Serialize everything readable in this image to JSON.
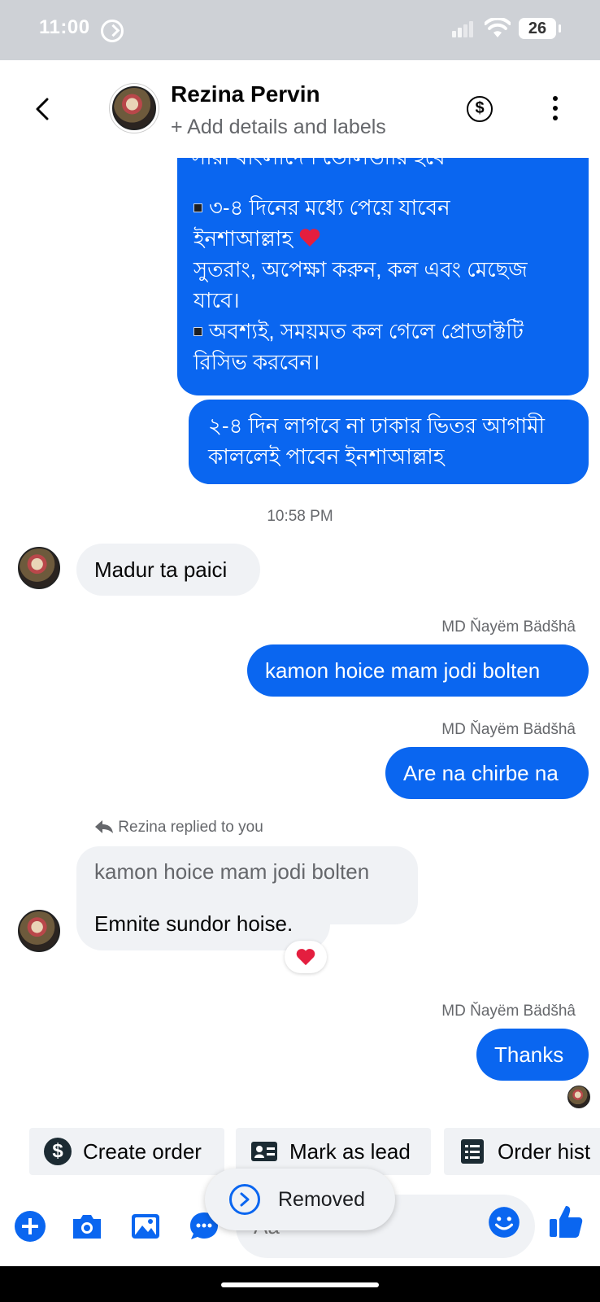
{
  "status_bar": {
    "time": "11:00",
    "battery": "26"
  },
  "header": {
    "contact_name": "Rezina Pervin",
    "subtitle": "+ Add details and labels",
    "dollar_icon": "$"
  },
  "messages": {
    "msg1_partial_top": "সারা বাংলাদেশ ডেলিভারি হবে",
    "msg1_line1": "৩-৪ দিনের মধ্যে পেয়ে যাবেন",
    "msg1_line2": "ইনশাআল্লাহ",
    "msg1_line3": "সুতরাং, অপেক্ষা করুন, কল এবং মেছেজ",
    "msg1_line4": "যাবে।",
    "msg1_line5": "অবশ্যই, সময়মত কল গেলে প্রোডাক্টটি",
    "msg1_line6": "রিসিভ করবেন।",
    "msg2_line1": "২-৪ দিন লাগবে না ঢাকার ভিতর আগামী",
    "msg2_line2": "কাললেই পাবেন ইনশাআল্লাহ",
    "timestamp": "10:58 PM",
    "msg3": "Madur ta paici",
    "sender1": "MD Ňayëm Bädšhâ",
    "msg4": "kamon hoice mam jodi bolten",
    "sender2": "MD Ňayëm Bädšhâ",
    "msg5": "Are na chirbe na",
    "reply_label": "Rezina replied to you",
    "quoted_text": "kamon hoice mam jodi bolten",
    "msg6": "Emnite sundor hoise.",
    "reaction": "heart",
    "sender3": "MD Ňayëm Bädšhâ",
    "msg7": "Thanks"
  },
  "quick_actions": [
    {
      "label": "Create order",
      "icon": "dollar-circle-icon"
    },
    {
      "label": "Mark as lead",
      "icon": "id-card-icon"
    },
    {
      "label": "Order hist",
      "icon": "list-document-icon"
    }
  ],
  "toast": {
    "label": "Removed"
  },
  "composer": {
    "placeholder": "Aa",
    "icons": [
      "plus-icon",
      "camera-icon",
      "gallery-icon",
      "chat-dots-icon",
      "emoji-icon",
      "thumbs-up-icon"
    ]
  },
  "colors": {
    "accent": "#0a66f0",
    "incoming_bubble": "#f0f2f5",
    "heart": "#e41e3f"
  }
}
